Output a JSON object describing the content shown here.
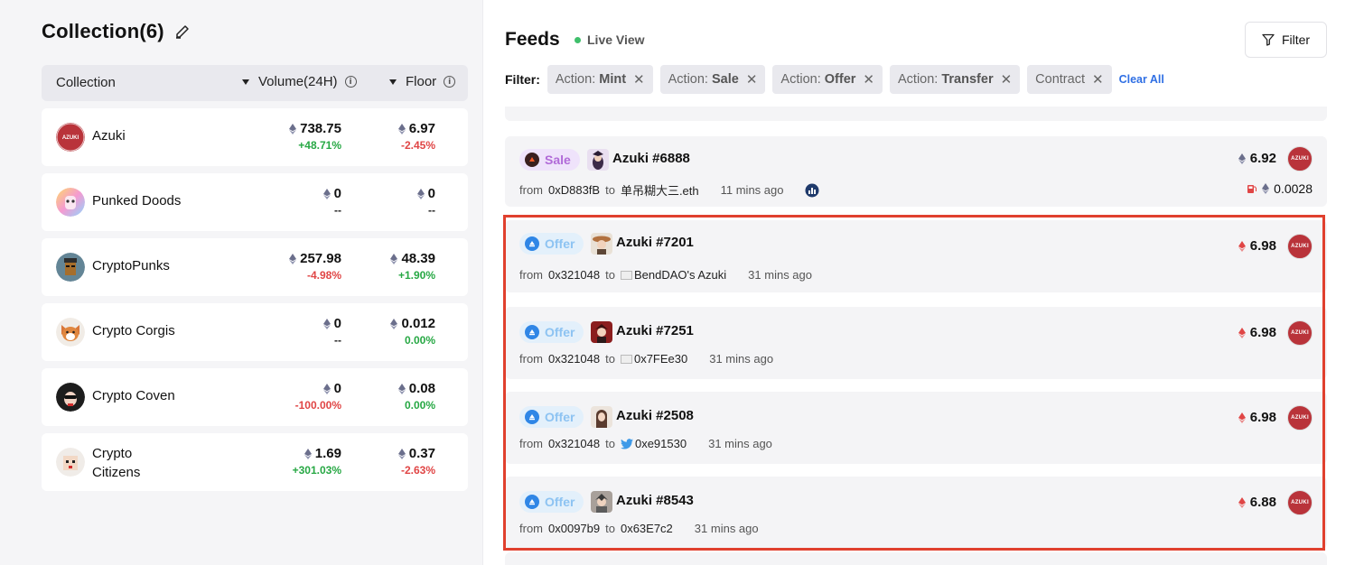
{
  "collection": {
    "title": "Collection(6)",
    "headers": {
      "name": "Collection",
      "volume": "Volume(24H)",
      "floor": "Floor"
    },
    "rows": [
      {
        "name": "Azuki",
        "volume": "738.75",
        "volume_change": "+48.71%",
        "volume_dir": "up",
        "floor": "6.97",
        "floor_change": "-2.45%",
        "floor_dir": "down"
      },
      {
        "name": "Punked Doods",
        "volume": "0",
        "volume_change": "--",
        "volume_dir": "none",
        "floor": "0",
        "floor_change": "--",
        "floor_dir": "none"
      },
      {
        "name": "CryptoPunks",
        "volume": "257.98",
        "volume_change": "-4.98%",
        "volume_dir": "down",
        "floor": "48.39",
        "floor_change": "+1.90%",
        "floor_dir": "up"
      },
      {
        "name": "Crypto Corgis",
        "volume": "0",
        "volume_change": "--",
        "volume_dir": "none",
        "floor": "0.012",
        "floor_change": "0.00%",
        "floor_dir": "up"
      },
      {
        "name": "Crypto Coven",
        "volume": "0",
        "volume_change": "-100.00%",
        "volume_dir": "down",
        "floor": "0.08",
        "floor_change": "0.00%",
        "floor_dir": "up"
      },
      {
        "name_line1": "Crypto",
        "name_line2": "Citizens",
        "volume": "1.69",
        "volume_change": "+301.03%",
        "volume_dir": "up",
        "floor": "0.37",
        "floor_change": "-2.63%",
        "floor_dir": "down"
      }
    ]
  },
  "feeds": {
    "title": "Feeds",
    "live_label": "Live View",
    "filter_button": "Filter",
    "filter_label": "Filter:",
    "chips": [
      {
        "key": "Action: ",
        "value": "Mint"
      },
      {
        "key": "Action: ",
        "value": "Sale"
      },
      {
        "key": "Action: ",
        "value": "Offer"
      },
      {
        "key": "Action: ",
        "value": "Transfer"
      },
      {
        "key": "Contract",
        "value": ""
      }
    ],
    "clear_all": "Clear All",
    "items": [
      {
        "action": "Sale",
        "token": "Azuki #6888",
        "from_label": "from",
        "from": "0xD883fB",
        "to_label": "to",
        "to": "单吊糊大三.eth",
        "time": "11 mins ago",
        "price": "6.92",
        "gas": "0.0028"
      },
      {
        "action": "Offer",
        "token": "Azuki #7201",
        "from_label": "from",
        "from": "0x321048",
        "to_label": "to",
        "to": "BendDAO's Azuki",
        "time": "31 mins ago",
        "price": "6.98"
      },
      {
        "action": "Offer",
        "token": "Azuki #7251",
        "from_label": "from",
        "from": "0x321048",
        "to_label": "to",
        "to": "0x7FEe30",
        "time": "31 mins ago",
        "price": "6.98"
      },
      {
        "action": "Offer",
        "token": "Azuki #2508",
        "from_label": "from",
        "from": "0x321048",
        "to_label": "to",
        "to": "0xe91530",
        "time": "31 mins ago",
        "price": "6.98"
      },
      {
        "action": "Offer",
        "token": "Azuki #8543",
        "from_label": "from",
        "from": "0x0097b9",
        "to_label": "to",
        "to": "0x63E7c2",
        "time": "31 mins ago",
        "price": "6.88"
      }
    ],
    "coin_text": "AZUKI"
  },
  "colors": {
    "up": "#27a844",
    "down": "#e04545",
    "highlight": "#e0402e",
    "link": "#2f6fe4"
  }
}
